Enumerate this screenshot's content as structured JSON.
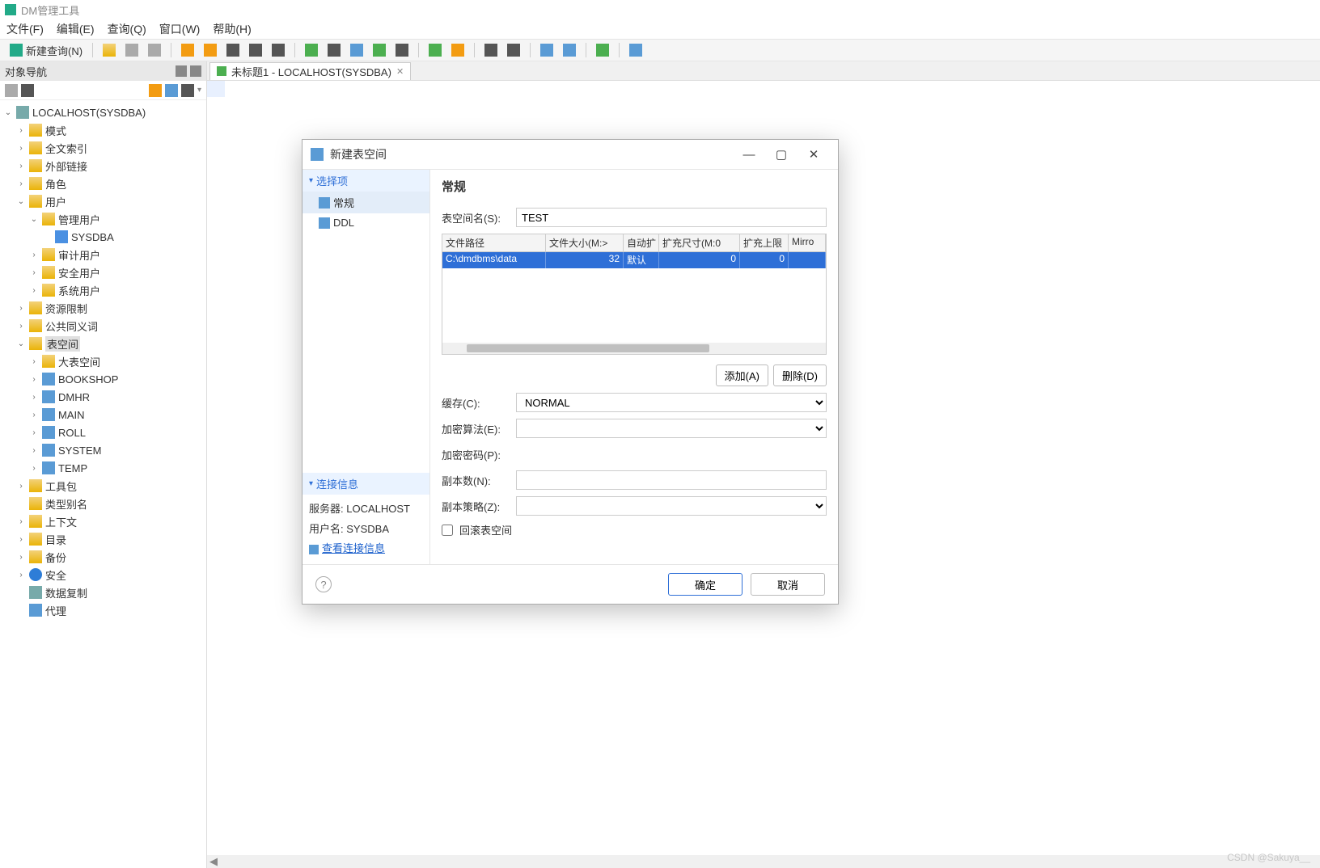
{
  "app": {
    "title": "DM管理工具"
  },
  "menu": {
    "file": "文件(F)",
    "edit": "编辑(E)",
    "query": "查询(Q)",
    "window": "窗口(W)",
    "help": "帮助(H)"
  },
  "toolbar": {
    "new_query": "新建查询(N)"
  },
  "sidebar": {
    "title": "对象导航",
    "root": "LOCALHOST(SYSDBA)",
    "items": {
      "mode": "模式",
      "fulltext": "全文索引",
      "extlink": "外部链接",
      "role": "角色",
      "user": "用户",
      "mgmt_user": "管理用户",
      "sysdba": "SYSDBA",
      "audit_user": "审计用户",
      "security_user": "安全用户",
      "system_user": "系统用户",
      "resource": "资源限制",
      "synonym": "公共同义词",
      "tablespace": "表空间",
      "ts_big": "大表空间",
      "ts_bookshop": "BOOKSHOP",
      "ts_dmhr": "DMHR",
      "ts_main": "MAIN",
      "ts_roll": "ROLL",
      "ts_system": "SYSTEM",
      "ts_temp": "TEMP",
      "toolkit": "工具包",
      "typealias": "类型别名",
      "context": "上下文",
      "catalog": "目录",
      "backup": "备份",
      "security": "安全",
      "replication": "数据复制",
      "agent": "代理"
    }
  },
  "editor": {
    "tab_title": "未标题1 - LOCALHOST(SYSDBA)"
  },
  "dialog": {
    "title": "新建表空间",
    "left": {
      "options": "选择项",
      "general": "常规",
      "ddl": "DDL",
      "conn": "连接信息",
      "server_label": "服务器:",
      "server": "LOCALHOST",
      "user_label": "用户名:",
      "user": "SYSDBA",
      "view_conn": "查看连接信息"
    },
    "right": {
      "heading": "常规",
      "name_label": "表空间名(S):",
      "name_value": "TEST",
      "grid_headers": [
        "文件路径",
        "文件大小(M:>",
        "自动扩",
        "扩充尺寸(M:0",
        "扩充上限",
        "Mirro"
      ],
      "grid_row": {
        "path": "C:\\dmdbms\\data",
        "size": "32",
        "auto": "默认",
        "ext_size": "0",
        "ext_limit": "0",
        "mirror": ""
      },
      "add": "添加(A)",
      "delete": "删除(D)",
      "cache_label": "缓存(C):",
      "cache_value": "NORMAL",
      "enc_alg_label": "加密算法(E):",
      "enc_alg_value": "",
      "enc_pwd_label": "加密密码(P):",
      "enc_pwd_value": "",
      "replica_label": "副本数(N):",
      "replica_value": "",
      "replica_policy_label": "副本策略(Z):",
      "replica_policy_value": "",
      "rollback_ts": "回滚表空间"
    },
    "footer": {
      "ok": "确定",
      "cancel": "取消"
    }
  },
  "watermark": "CSDN @Sakuya__"
}
